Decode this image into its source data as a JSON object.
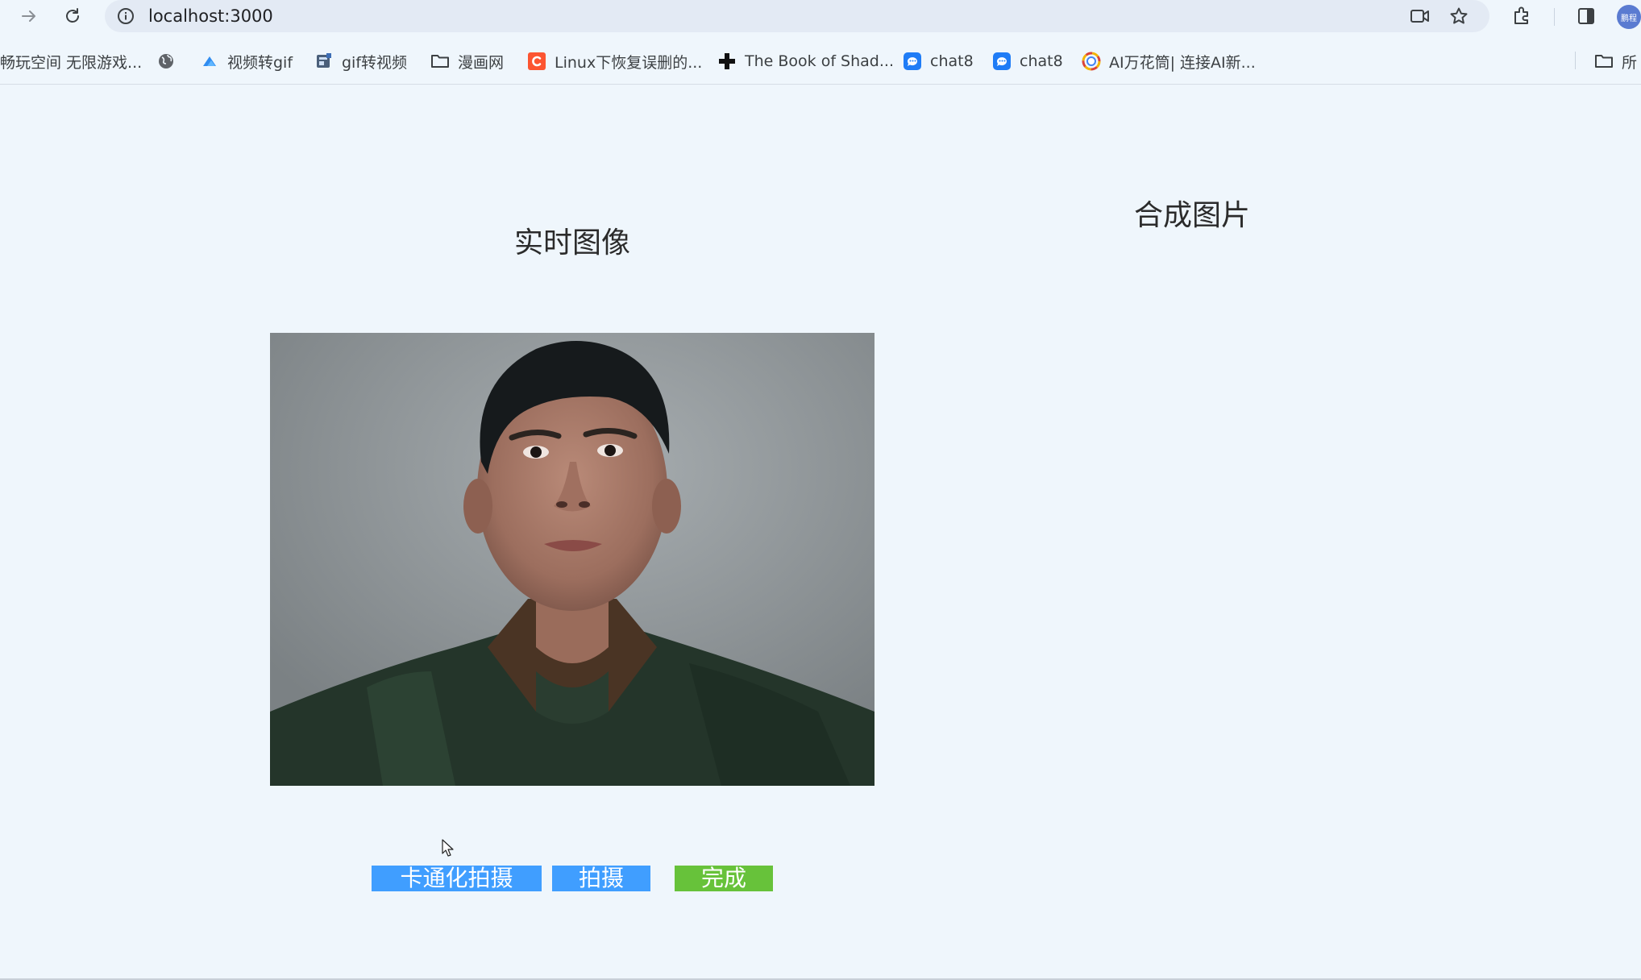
{
  "browser": {
    "url": "localhost:3000",
    "avatar_text": "鹏程"
  },
  "bookmarks": [
    {
      "label": "畅玩空间 无限游戏...",
      "icon": "none"
    },
    {
      "label": "",
      "icon": "globe-icon"
    },
    {
      "label": "视频转gif",
      "icon": "cloud-icon"
    },
    {
      "label": "gif转视频",
      "icon": "app-icon"
    },
    {
      "label": "漫画网",
      "icon": "folder-icon"
    },
    {
      "label": "Linux下恢复误删的...",
      "icon": "csdn-icon"
    },
    {
      "label": "The Book of Shad...",
      "icon": "cross-icon"
    },
    {
      "label": "chat8",
      "icon": "chat-icon"
    },
    {
      "label": "chat8",
      "icon": "chat-icon"
    },
    {
      "label": "AI万花筒| 连接AI新...",
      "icon": "kaleidoscope-icon"
    },
    {
      "label": "所",
      "icon": "folder-icon"
    }
  ],
  "page": {
    "live_title": "实时图像",
    "result_title": "合成图片",
    "buttons": {
      "cartoon": "卡通化拍摄",
      "capture": "拍摄",
      "done": "完成"
    }
  },
  "colors": {
    "page_bg": "#eff6fc",
    "primary": "#409eff",
    "success": "#67c23a"
  }
}
